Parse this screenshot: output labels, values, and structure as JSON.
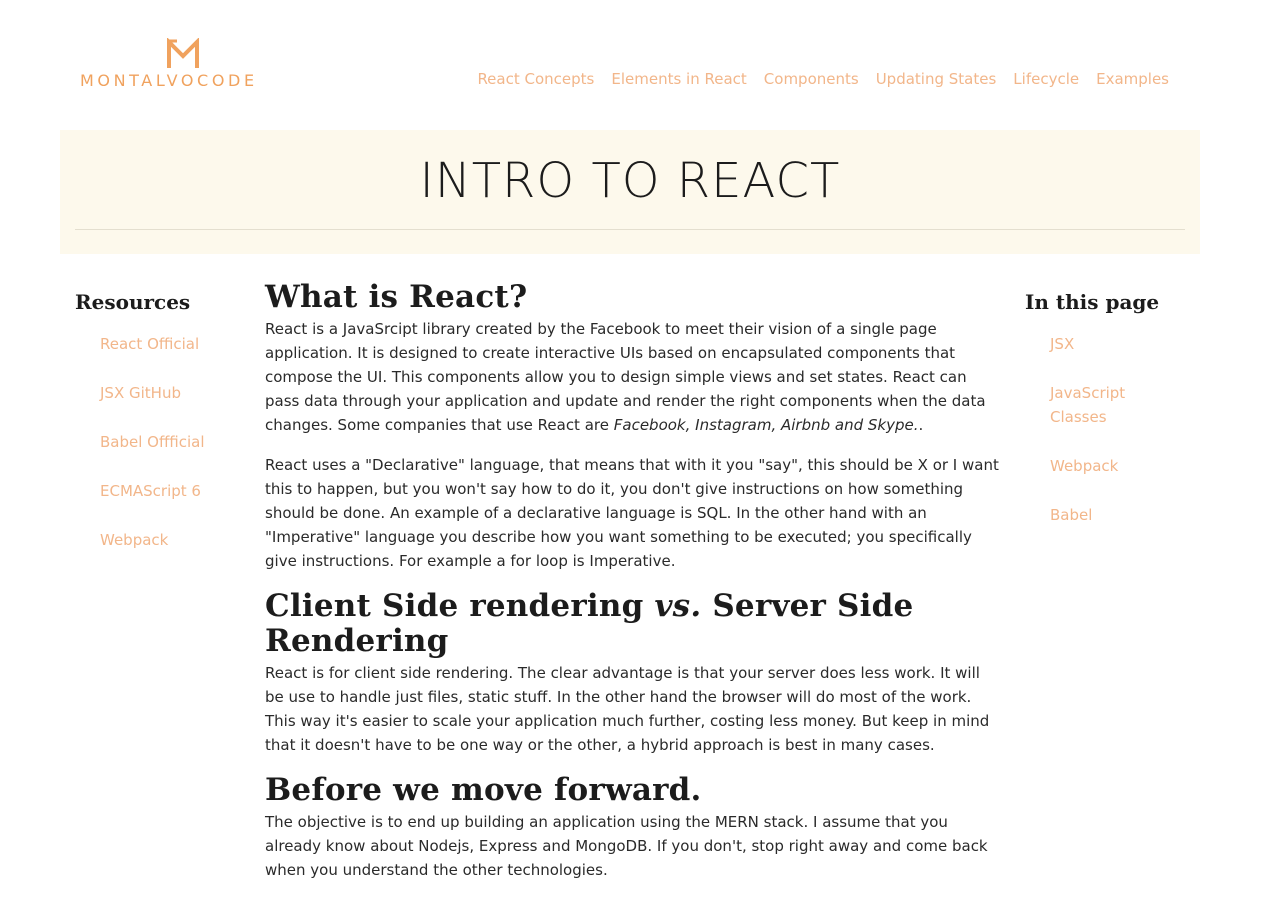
{
  "brand": {
    "mark": "M",
    "name": "MONTALVOCODE",
    "color": "#f0a25e"
  },
  "nav": [
    "React Concepts",
    "Elements in React",
    "Components",
    "Updating States",
    "Lifecycle",
    "Examples"
  ],
  "banner": {
    "title": "INTRO TO REACT"
  },
  "resources": {
    "title": "Resources",
    "items": [
      "React Official",
      "JSX GitHub",
      "Babel Offficial",
      "ECMAScript 6",
      "Webpack"
    ]
  },
  "toc": {
    "title": "In this page",
    "items": [
      "JSX",
      "JavaScript Classes",
      "Webpack",
      "Babel"
    ]
  },
  "sections": {
    "what": {
      "heading": "What is React?",
      "p1_text": "React is a JavaSrcipt library created by the Facebook to meet their vision of a single page application. It is designed to create interactive UIs based on encapsulated components that compose the UI. This components allow you to design simple views and set states. React can pass data through your application and update and render the right components when the data changes. Some companies that use React are ",
      "p1_em": "Facebook, Instagram, Airbnb and Skype.",
      "p1_end": ".",
      "p2": "React uses a \"Declarative\" language, that means that with it you \"say\", this should be X or I want this to happen, but you won't say how to do it, you don't give instructions on how something should be done. An example of a declarative language is SQL. In the other hand with an \"Imperative\" language you describe how you want something to be executed; you specifically give instructions. For example a for loop is Imperative."
    },
    "rendering": {
      "heading_a": "Client Side rendering ",
      "heading_vs": "vs.",
      "heading_b": " Server Side Rendering",
      "p1": "React is for client side rendering. The clear advantage is that your server does less work. It will be use to handle just files, static stuff. In the other hand the browser will do most of the work. This way it's easier to scale your application much further, costing less money. But keep in mind that it doesn't have to be one way or the other, a hybrid approach is best in many cases."
    },
    "before": {
      "heading": "Before we move forward.",
      "p1": "The objective is to end up building an application using the MERN stack. I assume that you already know about Nodejs, Express and MongoDB. If you don't, stop right away and come back when you understand the other technologies."
    }
  }
}
